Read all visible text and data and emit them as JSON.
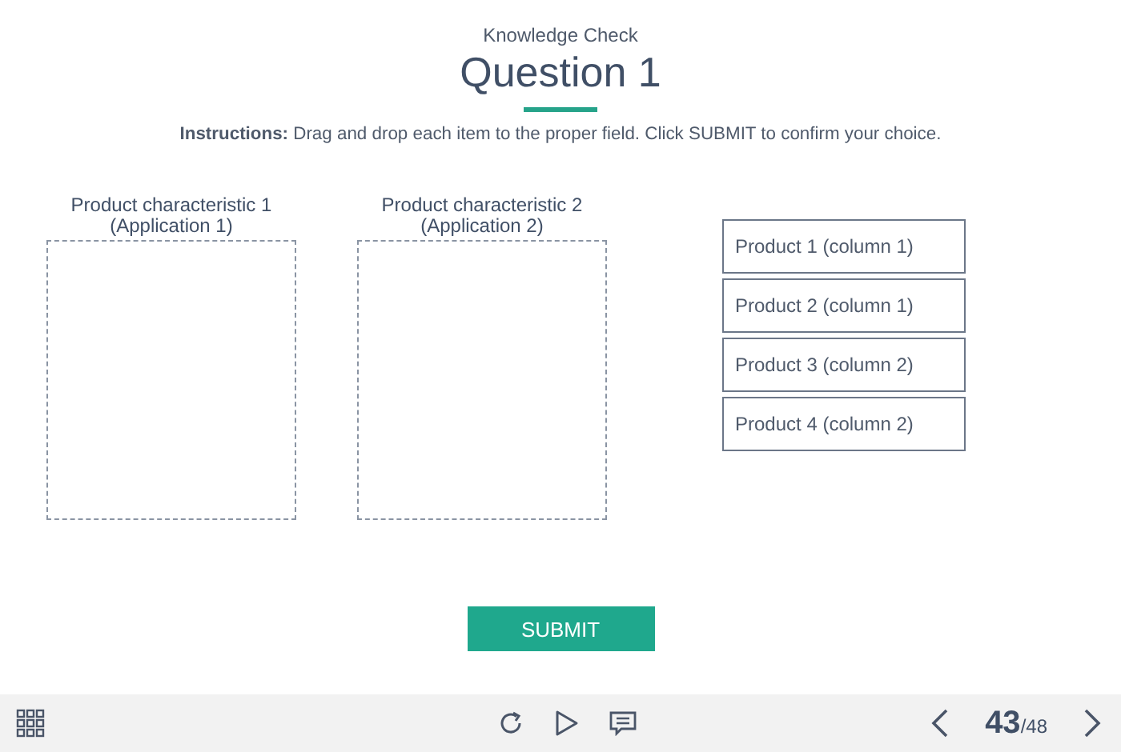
{
  "header": {
    "subtitle": "Knowledge Check",
    "title": "Question 1"
  },
  "instructions": "**Instructions:** Drag and drop each item to the proper field. Click SUBMIT to confirm your choice.",
  "drop_zones": [
    {
      "label": "Product characteristic 1\n(Application 1)"
    },
    {
      "label": "Product characteristic 2\n(Application 2)"
    }
  ],
  "items": [
    "Product 1 (column 1)",
    "Product 2 (column 1)",
    "Product 3 (column 2)",
    "Product 4 (column 2)"
  ],
  "submit": "SUBMIT",
  "footer": {
    "page": "43",
    "total": "/48"
  }
}
